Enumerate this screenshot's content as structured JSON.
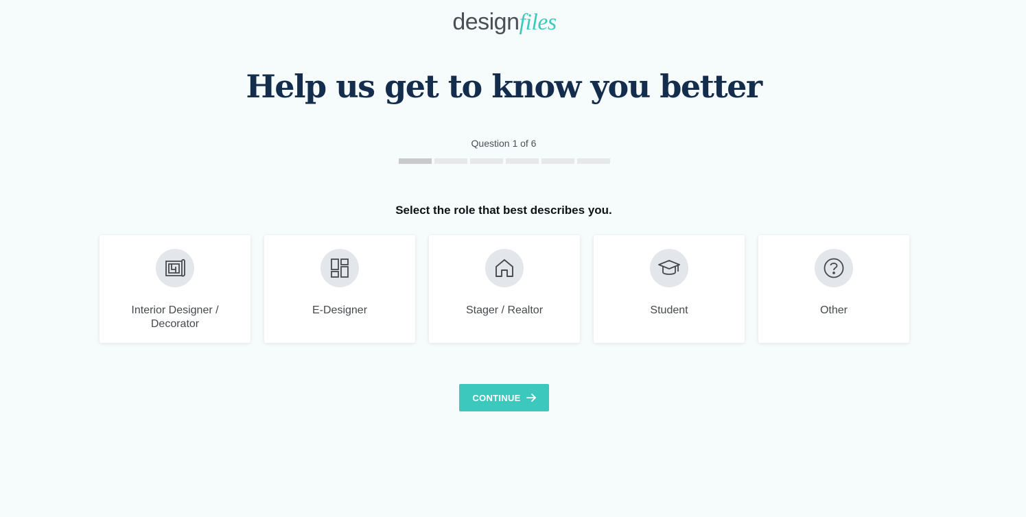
{
  "logo": {
    "part_a": "design",
    "part_b": "files",
    "color_a": "#4a4f55",
    "color_b": "#3fc9bd"
  },
  "headline": "Help us get to know you better",
  "progress": {
    "counter_text": "Question 1 of 6",
    "current": 1,
    "total": 6
  },
  "prompt": "Select the role that best describes you.",
  "roles": [
    {
      "label": "Interior Designer / Decorator",
      "icon": "blueprint-icon"
    },
    {
      "label": "E-Designer",
      "icon": "layout-grid-icon"
    },
    {
      "label": "Stager / Realtor",
      "icon": "house-icon"
    },
    {
      "label": "Student",
      "icon": "graduation-cap-icon"
    },
    {
      "label": "Other",
      "icon": "question-circle-icon"
    }
  ],
  "continue_button": {
    "label": "CONTINUE",
    "icon": "arrow-right-icon"
  },
  "colors": {
    "accent": "#3cc8bc",
    "headline": "#142d4d",
    "background": "#f6fcfc"
  }
}
